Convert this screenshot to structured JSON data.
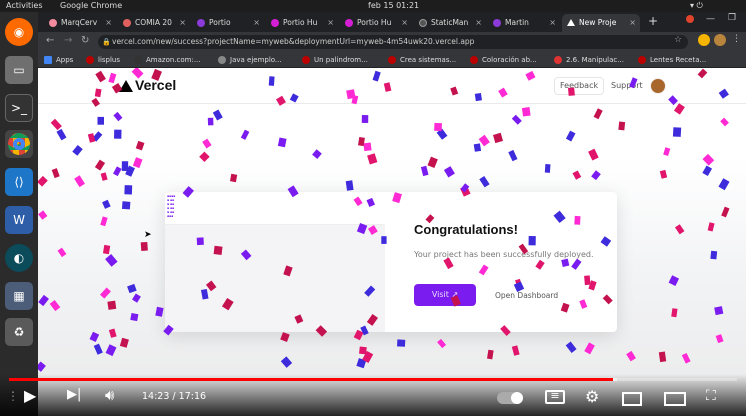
{
  "topbar": {
    "activities": "Activities",
    "app": "Google Chrome",
    "clock": "feb 15  01:21"
  },
  "tabs": [
    {
      "label": "MarqCerv",
      "color": "#f38ba0"
    },
    {
      "label": "COMIA 20",
      "color": "#e06060"
    },
    {
      "label": "Portio",
      "color": "#8b3bd9"
    },
    {
      "label": "Portio Hu",
      "color": "#d41fd4"
    },
    {
      "label": "Portio Hu",
      "color": "#d41fd4"
    },
    {
      "label": "StaticMan",
      "color": "#555"
    },
    {
      "label": "Martin",
      "color": "#8b3bd9"
    },
    {
      "label": "New Proje",
      "color": "#fff"
    }
  ],
  "address": {
    "url": "vercel.com/new/success?projectName=myweb&deploymentUrl=myweb-4m54uwk20.vercel.app"
  },
  "bookmarks": [
    "Apps",
    "lisplus",
    "Amazon.com:...",
    "Java ejemplo...",
    "Un palindrom...",
    "Crea sistemas...",
    "Coloración ab...",
    "2.6. Manipulac...",
    "Lentes Receta..."
  ],
  "vercel": {
    "brand": "Vercel",
    "feedback": "Feedback",
    "support": "Support",
    "title": "Congratulations!",
    "subtitle": "Your project has been successfully deployed.",
    "visit": "Visit",
    "open_dashboard": "Open Dashboard"
  },
  "player": {
    "current": "14:23",
    "separator": "/",
    "total": "17:16",
    "progress": 0.829,
    "buffered": 0.835
  },
  "colors": {
    "accent": "#7a1cf0",
    "confetti": [
      "#e0156b",
      "#7a1cf0",
      "#3d2bdc",
      "#ff2ad4",
      "#c4124f"
    ]
  }
}
